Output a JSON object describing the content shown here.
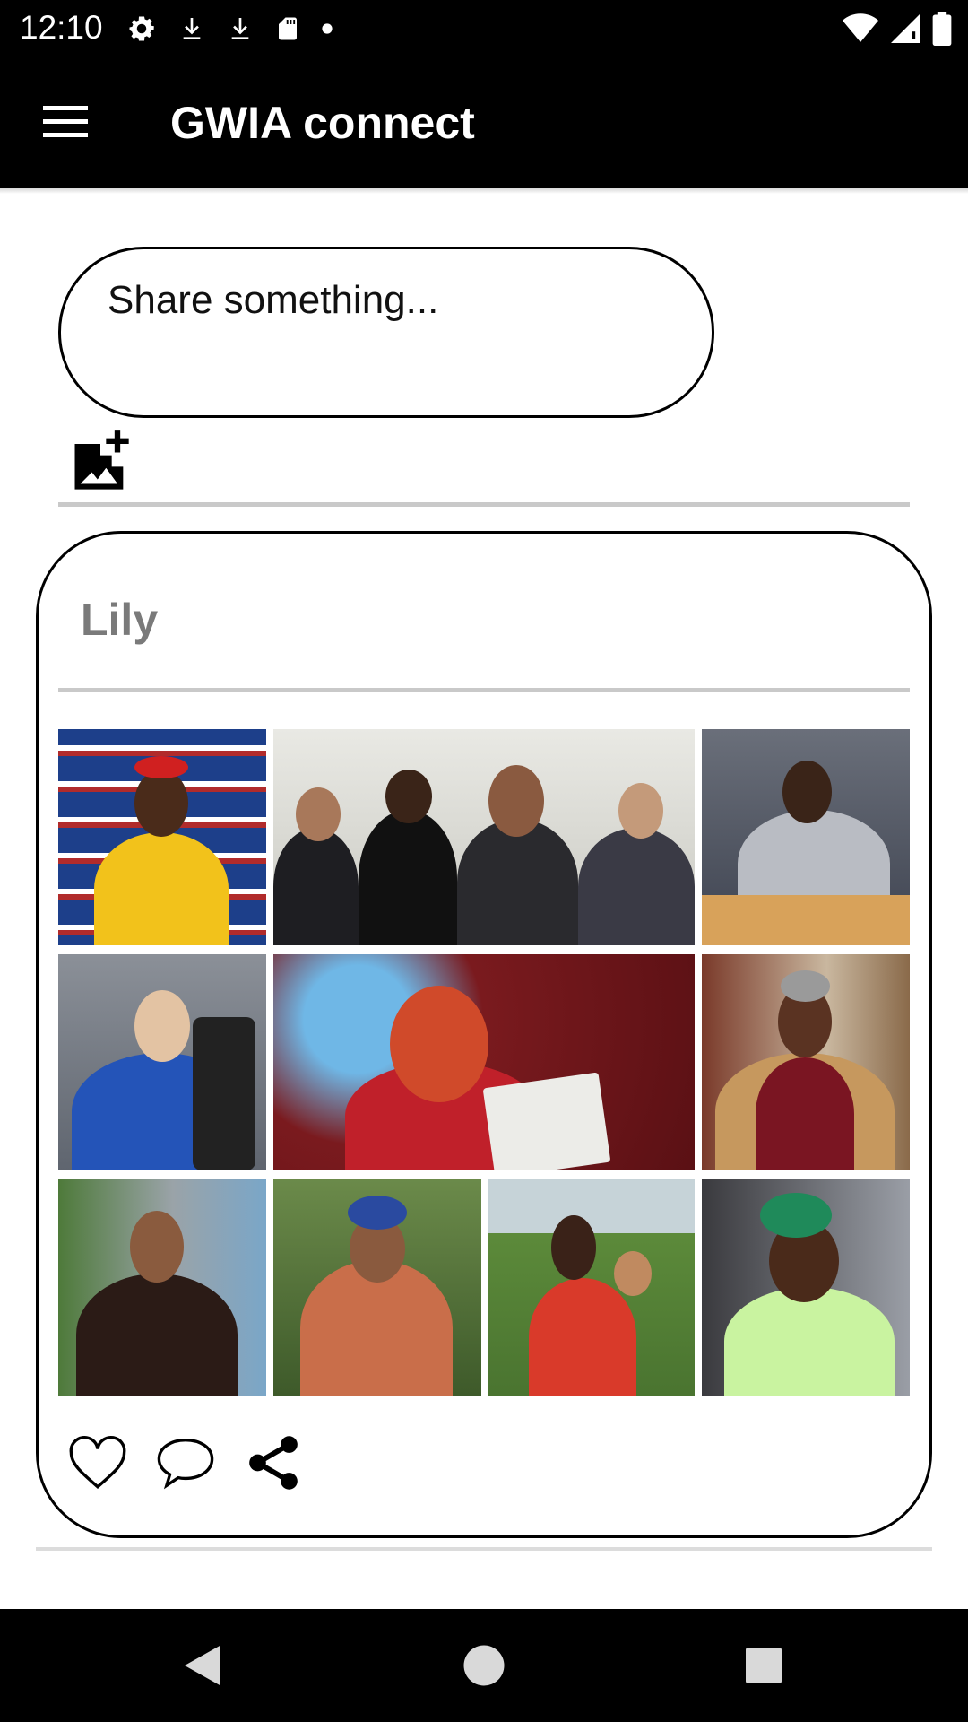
{
  "status_bar": {
    "time": "12:10",
    "left_icons": [
      "settings-icon",
      "download-icon",
      "download-icon",
      "sd-card-icon",
      "dot-icon"
    ],
    "right_icons": [
      "wifi-icon",
      "signal-icon",
      "battery-icon"
    ]
  },
  "app_bar": {
    "menu_icon": "hamburger-menu-icon",
    "title": "GWIA connect"
  },
  "composer": {
    "placeholder": "Share something...",
    "add_photo_icon": "add-photo-icon"
  },
  "post": {
    "author": "Lily",
    "photo_count": 10,
    "actions": [
      "heart-icon",
      "comment-icon",
      "share-icon"
    ]
  },
  "nav_bar": {
    "buttons": [
      "back-icon",
      "home-icon",
      "recents-icon"
    ]
  },
  "colors": {
    "bar_background": "#000000",
    "divider": "#c9c9c9",
    "author_text": "#7a7a7a"
  }
}
